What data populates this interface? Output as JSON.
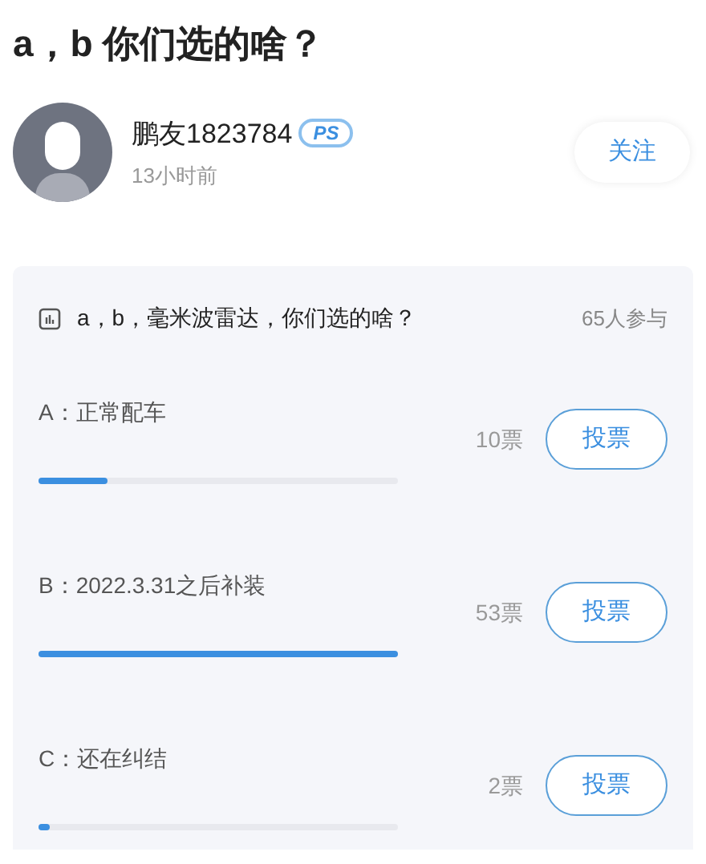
{
  "title": "a，b 你们选的啥？",
  "author": {
    "name": "鹏友1823784",
    "badge": "PS",
    "time": "13小时前",
    "follow_label": "关注"
  },
  "poll": {
    "question": "a，b，毫米波雷达，你们选的啥？",
    "participants": "65人参与",
    "options": [
      {
        "label": "A：正常配车",
        "votes": "10票",
        "level": 0.19,
        "button": "投票"
      },
      {
        "label": "B：2022.3.31之后补装",
        "votes": "53票",
        "level": 1,
        "button": "投票"
      },
      {
        "label": "C：还在纠结",
        "votes": "2票",
        "level": 0.03,
        "button": "投票"
      }
    ]
  }
}
